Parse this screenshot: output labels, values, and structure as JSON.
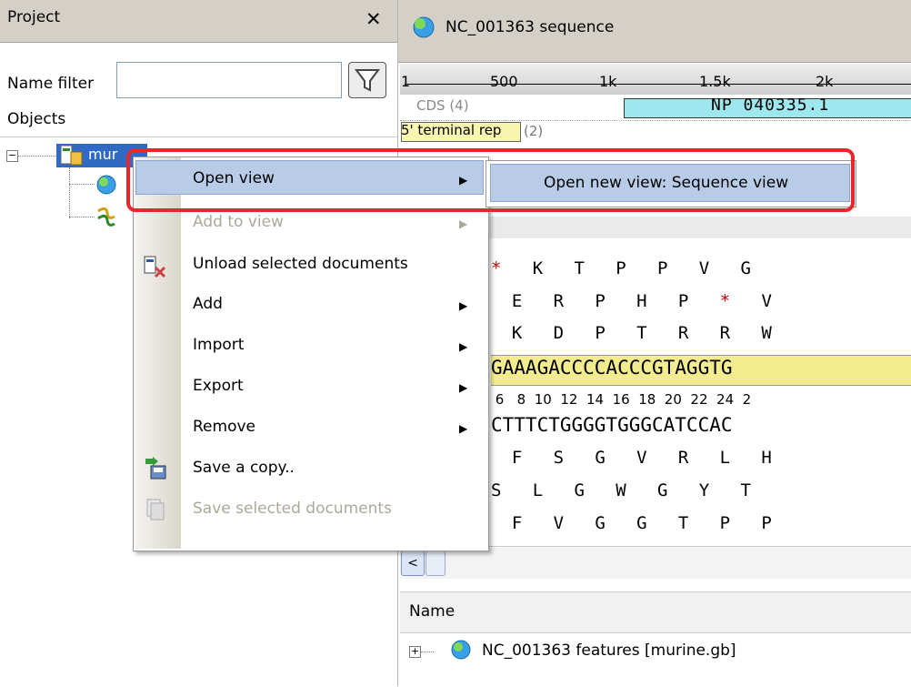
{
  "project_panel": {
    "title": "Project",
    "close_glyph": "✕",
    "name_filter_label": "Name filter",
    "name_filter_value": "",
    "objects_label": "Objects",
    "tree": {
      "document_label": "mur",
      "expander": "−"
    }
  },
  "sequence_view": {
    "title": "NC_001363 sequence",
    "ruler_ticks": [
      "1",
      "500",
      "1k",
      "1.5k",
      "2k"
    ],
    "cds_track_label": "CDS (4)",
    "cds_feature_name": "NP 040335.1",
    "terminal_repeat_label": "5' terminal rep",
    "terminal_repeat_count": "(2)",
    "rows": {
      "aa1": "*   K   T   P   P   V   G",
      "aa2": "  E   R   P   H   P   *   V",
      "aa3": "  K   D   P   T   R   R   W",
      "dna_top": "GAAAGACCCCACCCGTAGGTG",
      "positions": " 6   8  10  12  14  16  18  20  22  24  2",
      "dna_bottom": "CTTTCTGGGGTGGGCATCCAC",
      "aa4": "  F   S   G   V   R   L   H",
      "aa5": "S   L   G   W   G   Y   T",
      "aa6": "  F   V   G   G   T   P   P"
    },
    "scroll_left_glyph": "<"
  },
  "objects_panel": {
    "column_header": "Name",
    "expander": "+",
    "items": [
      "NC_001363 features [murine.gb]"
    ]
  },
  "context_menu": {
    "items": [
      {
        "label": "Open view",
        "enabled": true,
        "submenu": true
      },
      {
        "label": "Add to view",
        "enabled": false,
        "submenu": true
      },
      {
        "label": "Unload selected documents",
        "enabled": true,
        "submenu": false
      },
      {
        "label": "Add",
        "enabled": true,
        "submenu": true
      },
      {
        "label": "Import",
        "enabled": true,
        "submenu": true
      },
      {
        "label": "Export",
        "enabled": true,
        "submenu": true
      },
      {
        "label": "Remove",
        "enabled": true,
        "submenu": true
      },
      {
        "label": "Save a copy..",
        "enabled": true,
        "submenu": false
      },
      {
        "label": "Save selected documents",
        "enabled": false,
        "submenu": false
      }
    ],
    "submenu_arrow": "▶",
    "submenu_item": "Open new view: Sequence view"
  },
  "colors": {
    "selection": "#316ac5",
    "menu_highlight": "#b8cce8",
    "annotation_red": "#e8262c",
    "cds_fill": "#9de8ef",
    "dna_highlight": "#f3ec8e"
  }
}
